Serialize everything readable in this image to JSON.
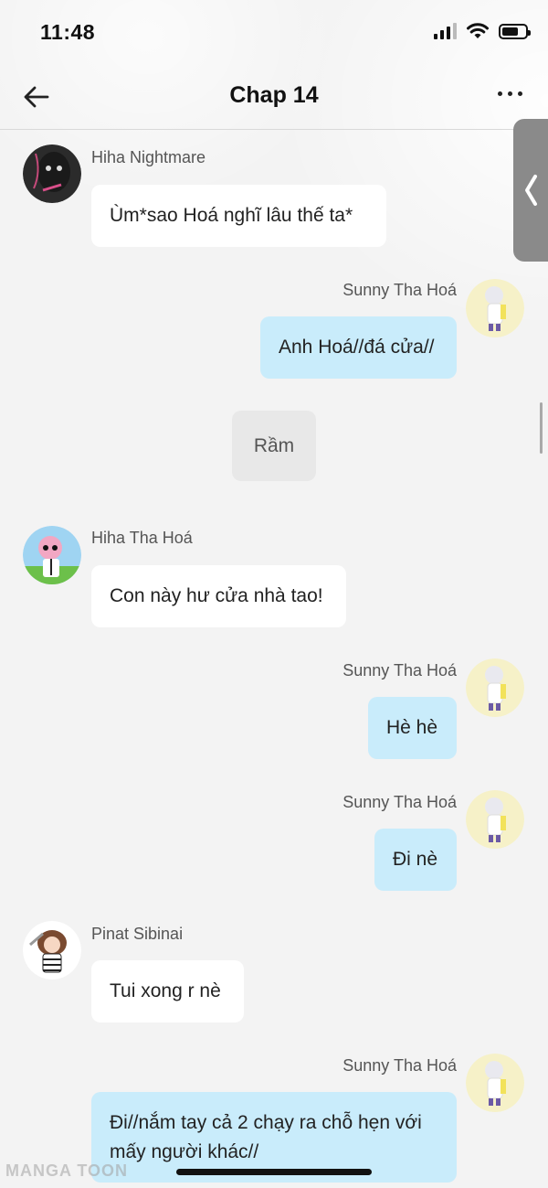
{
  "status": {
    "time": "11:48"
  },
  "nav": {
    "title": "Chap 14"
  },
  "messages": [
    {
      "sender": "Hiha Nightmare",
      "text": "Ùm*sao Hoá nghĩ lâu thế ta*",
      "side": "left",
      "avatar": "dark-creature-avatar"
    },
    {
      "sender": "Sunny Tha Hoá",
      "text": "Anh Hoá//đá cửa//",
      "side": "right",
      "avatar": "white-hair-chibi-avatar"
    },
    {
      "text": "Rầm",
      "side": "center"
    },
    {
      "sender": "Hiha Tha Hoá",
      "text": "Con này hư cửa nhà tao!",
      "side": "left",
      "avatar": "pink-hair-chibi-avatar"
    },
    {
      "sender": "Sunny Tha Hoá",
      "text": "Hè hè",
      "side": "right",
      "avatar": "white-hair-chibi-avatar"
    },
    {
      "sender": "Sunny Tha Hoá",
      "text": "Đi nè",
      "side": "right",
      "avatar": "white-hair-chibi-avatar"
    },
    {
      "sender": "Pinat Sibinai",
      "text": "Tui xong r nè",
      "side": "left",
      "avatar": "brown-hair-chibi-avatar"
    },
    {
      "sender": "Sunny Tha Hoá",
      "text_line1": "Đi//nắm tay cả 2 chạy ra chỗ hẹn với",
      "text_line2": "mấy người khác//",
      "side": "right",
      "avatar": "white-hair-chibi-avatar"
    }
  ],
  "watermark": "MANGA TOON"
}
